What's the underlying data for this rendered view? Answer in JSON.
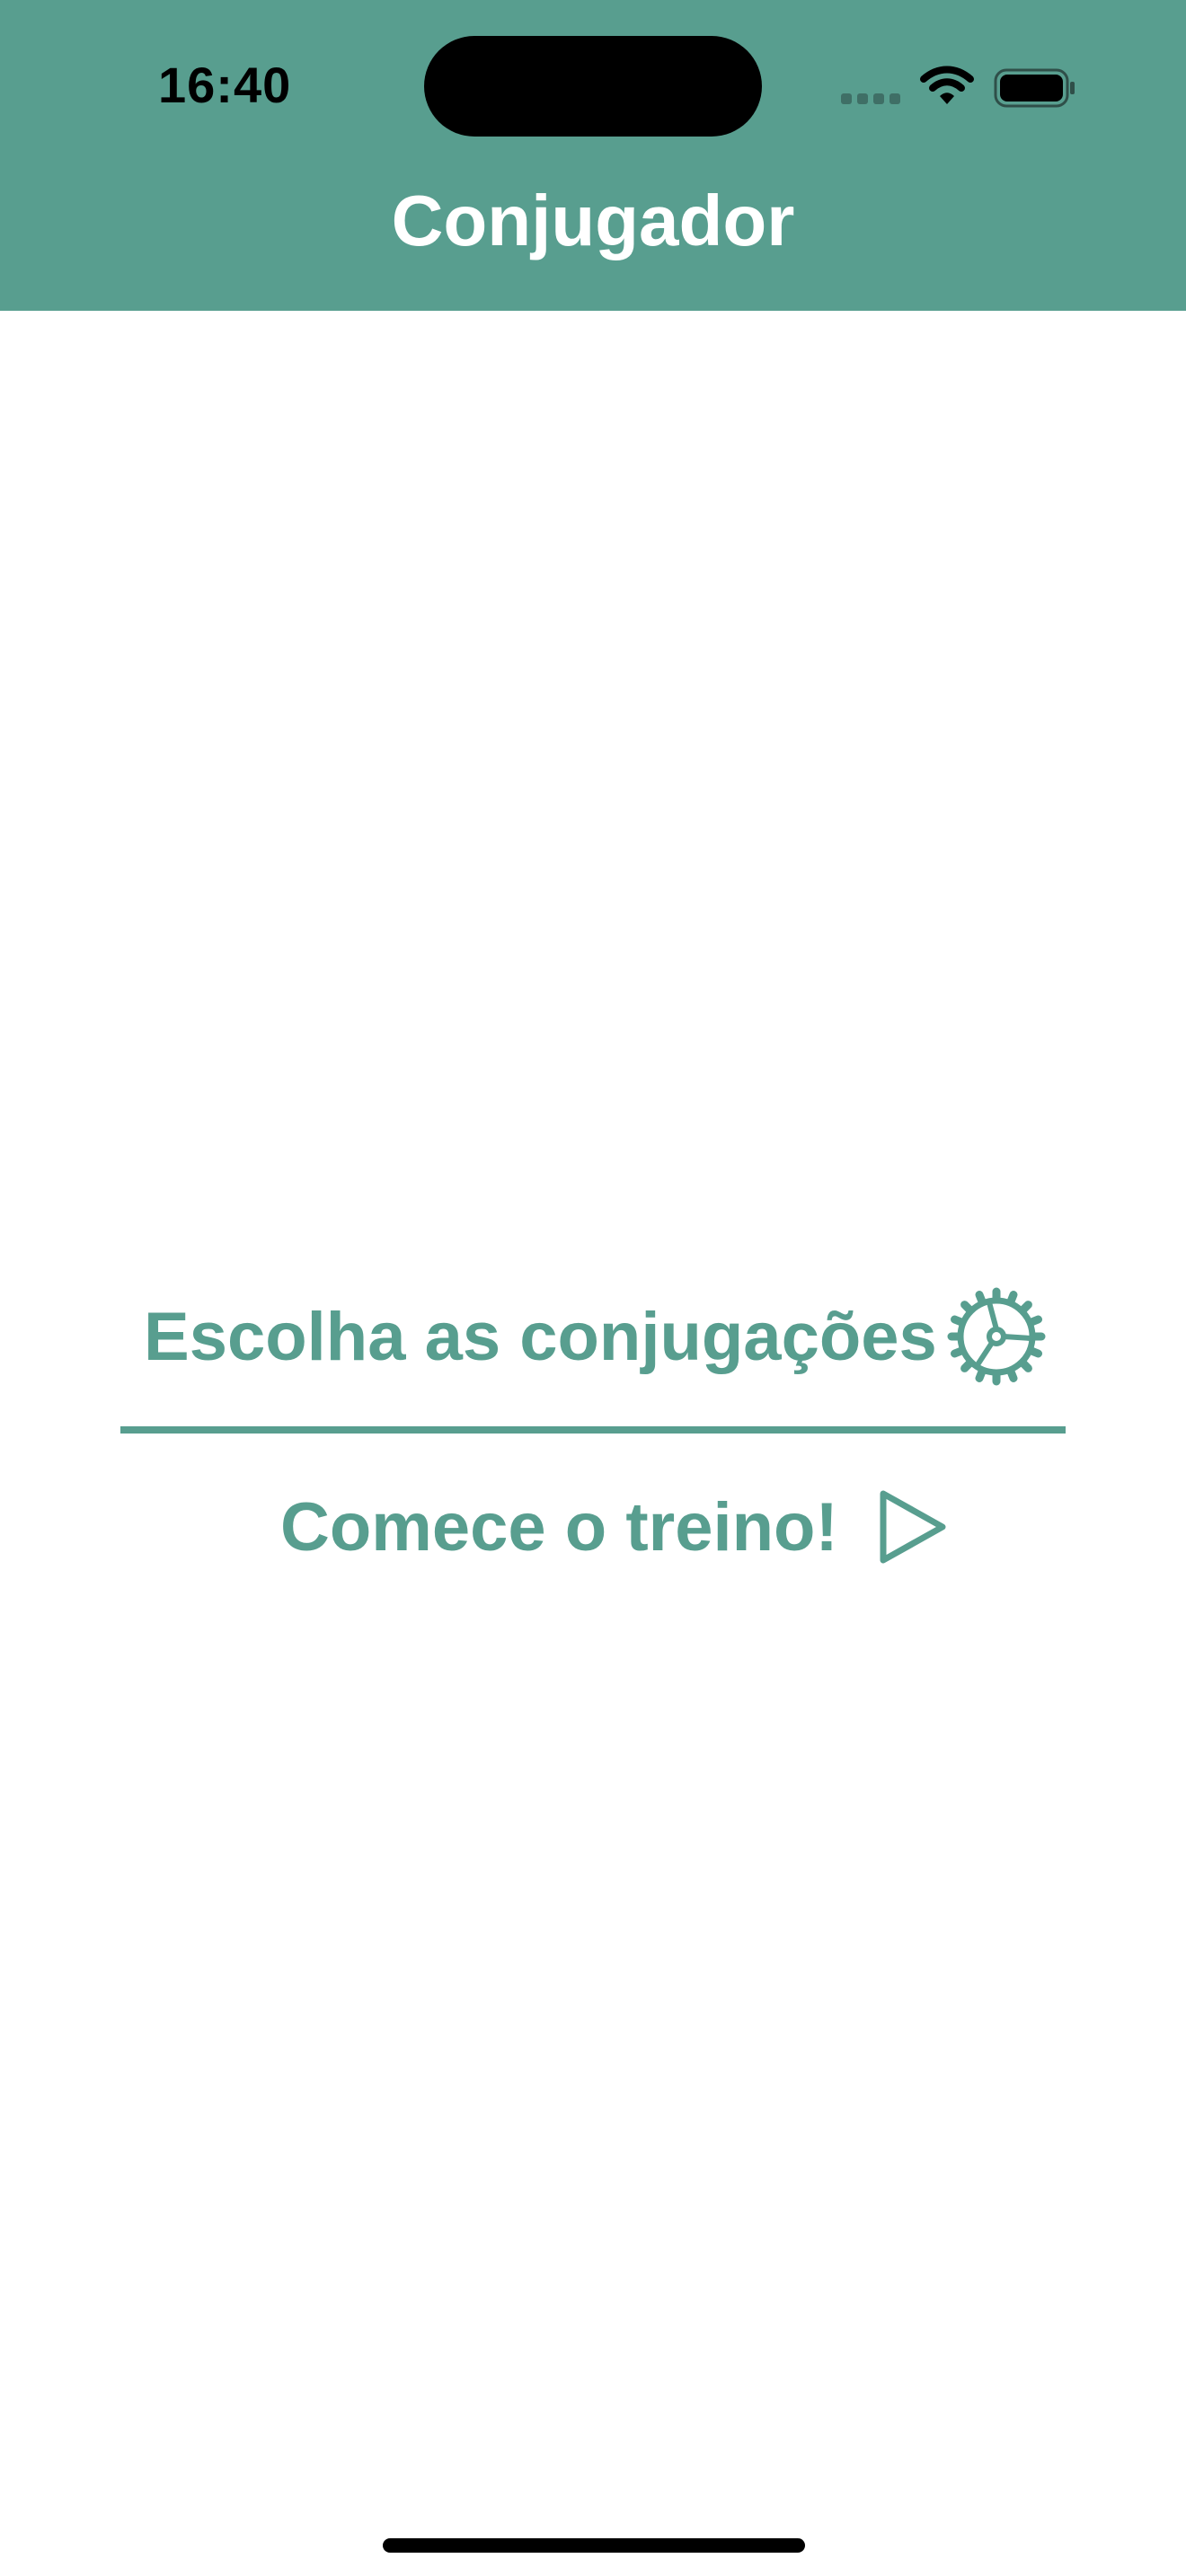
{
  "status_bar": {
    "time": "16:40"
  },
  "header": {
    "title": "Conjugador",
    "background_color": "#589e8f",
    "title_color": "#ffffff"
  },
  "menu": {
    "choose_conjugations": {
      "label": "Escolha as conjugações",
      "icon": "gear-icon"
    },
    "start_training": {
      "label": "Comece o treino!",
      "icon": "play-icon"
    },
    "accent_color": "#589e8f"
  },
  "icons": {
    "status": [
      "cellular-signal-icon",
      "wifi-icon",
      "battery-icon"
    ]
  }
}
